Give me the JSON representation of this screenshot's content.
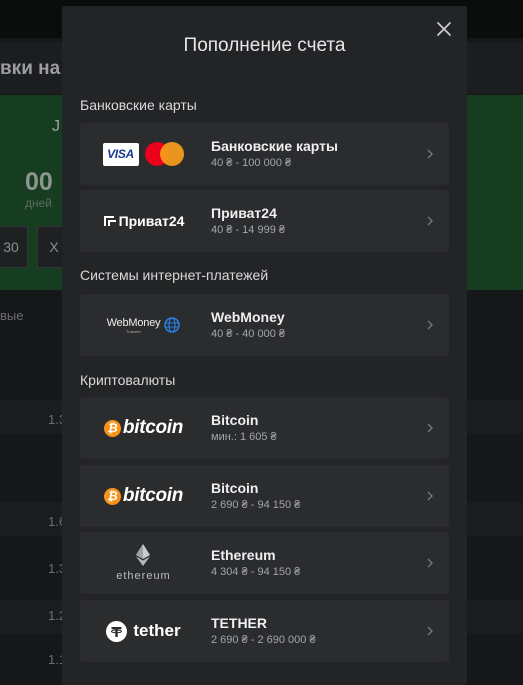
{
  "background": {
    "headline_fragment": "вки на",
    "banner_letter": "J",
    "timer_value": "00",
    "timer_unit": "дней",
    "box1": "30",
    "box2": "X",
    "types_fragment": "вые",
    "row_numbers": [
      "1.3",
      "1.6",
      "1.3",
      "1.2",
      "1.1"
    ],
    "right_fragments": [
      ")",
      ")",
      ")"
    ]
  },
  "modal": {
    "title": "Пополнение счета",
    "close_icon": "close-icon",
    "sections": [
      {
        "label": "Банковские карты",
        "methods": [
          {
            "name": "Банковские карты",
            "range": "40 ₴ - 100 000 ₴",
            "logo": "visa-mastercard-logo",
            "logo_text": "VISA"
          },
          {
            "name": "Приват24",
            "range": "40 ₴ - 14 999 ₴",
            "logo": "privat24-logo",
            "logo_text": "Приват24"
          }
        ]
      },
      {
        "label": "Системы интернет-платежей",
        "methods": [
          {
            "name": "WebMoney",
            "range": "40 ₴ - 40 000 ₴",
            "logo": "webmoney-logo",
            "logo_text": "WebMoney",
            "logo_subtext": "Transfer"
          }
        ]
      },
      {
        "label": "Криптовалюты",
        "methods": [
          {
            "name": "Bitcoin",
            "range": "мин.: 1 605 ₴",
            "logo": "bitcoin-logo",
            "logo_text": "bitcoin"
          },
          {
            "name": "Bitcoin",
            "range": "2 690 ₴ - 94 150 ₴",
            "logo": "bitcoin-logo",
            "logo_text": "bitcoin"
          },
          {
            "name": "Ethereum",
            "range": "4 304 ₴ - 94 150 ₴",
            "logo": "ethereum-logo",
            "logo_text": "ethereum"
          },
          {
            "name": "TETHER",
            "range": "2 690 ₴ - 2 690 000 ₴",
            "logo": "tether-logo",
            "logo_text": "tether"
          }
        ]
      }
    ]
  },
  "colors": {
    "modal_bg": "#232426",
    "card_bg": "#2b2c2e",
    "banner_green": "#163d20",
    "bitcoin_orange": "#f7931a",
    "mastercard_red": "#eb001b",
    "mastercard_yellow": "#f79e1b"
  }
}
